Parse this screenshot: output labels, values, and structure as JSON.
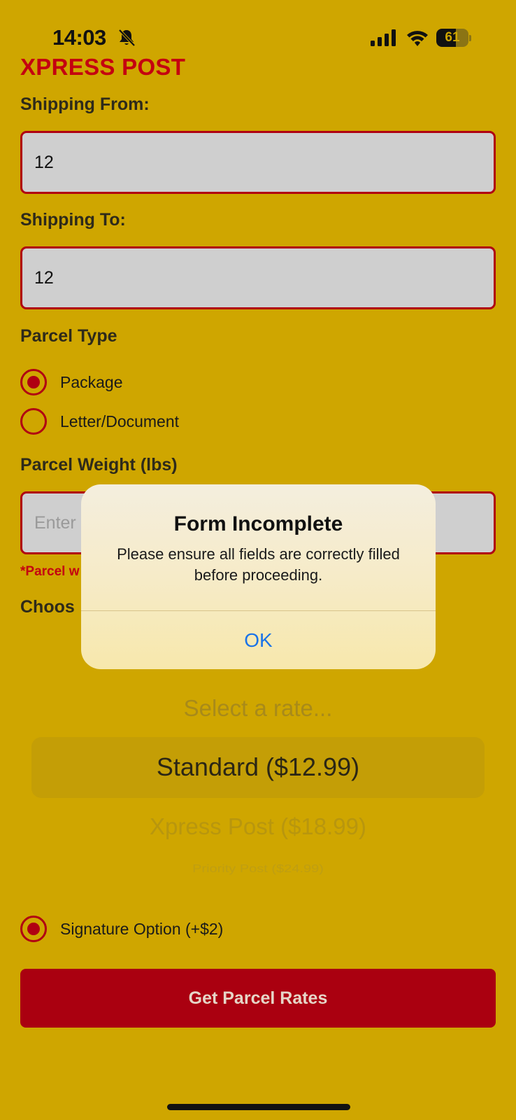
{
  "status_bar": {
    "time": "14:03",
    "battery_level": "61",
    "battery_fraction": 0.61,
    "icons": [
      "bell-slash-icon",
      "signal-icon",
      "wifi-icon",
      "battery-icon"
    ]
  },
  "app": {
    "title": "XPRESS POST"
  },
  "form": {
    "shipping_from": {
      "label": "Shipping From:",
      "value": "12"
    },
    "shipping_to": {
      "label": "Shipping To:",
      "value": "12"
    },
    "parcel_type": {
      "label": "Parcel Type",
      "options": [
        {
          "label": "Package",
          "selected": true
        },
        {
          "label": "Letter/Document",
          "selected": false
        }
      ]
    },
    "parcel_weight": {
      "label": "Parcel Weight (lbs)",
      "placeholder": "Enter",
      "error": "*Parcel w"
    },
    "rate": {
      "label": "Choos",
      "placeholder": "Select a rate...",
      "options": [
        "Standard ($12.99)",
        "Xpress Post ($18.99)",
        "Priority Post ($24.99)"
      ],
      "selected": "Standard ($12.99)"
    },
    "signature_option": {
      "label": "Signature Option (+$2)",
      "selected": true
    },
    "submit_label": "Get Parcel Rates"
  },
  "alert": {
    "title": "Form Incomplete",
    "message": "Please ensure all fields are correctly filled before proceeding.",
    "ok_label": "OK"
  },
  "colors": {
    "background": "#CFA600",
    "accent_red": "#B00012",
    "title_red": "#C40010",
    "field_bg": "#CFCFCF",
    "alert_link_blue": "#1A73E8"
  }
}
